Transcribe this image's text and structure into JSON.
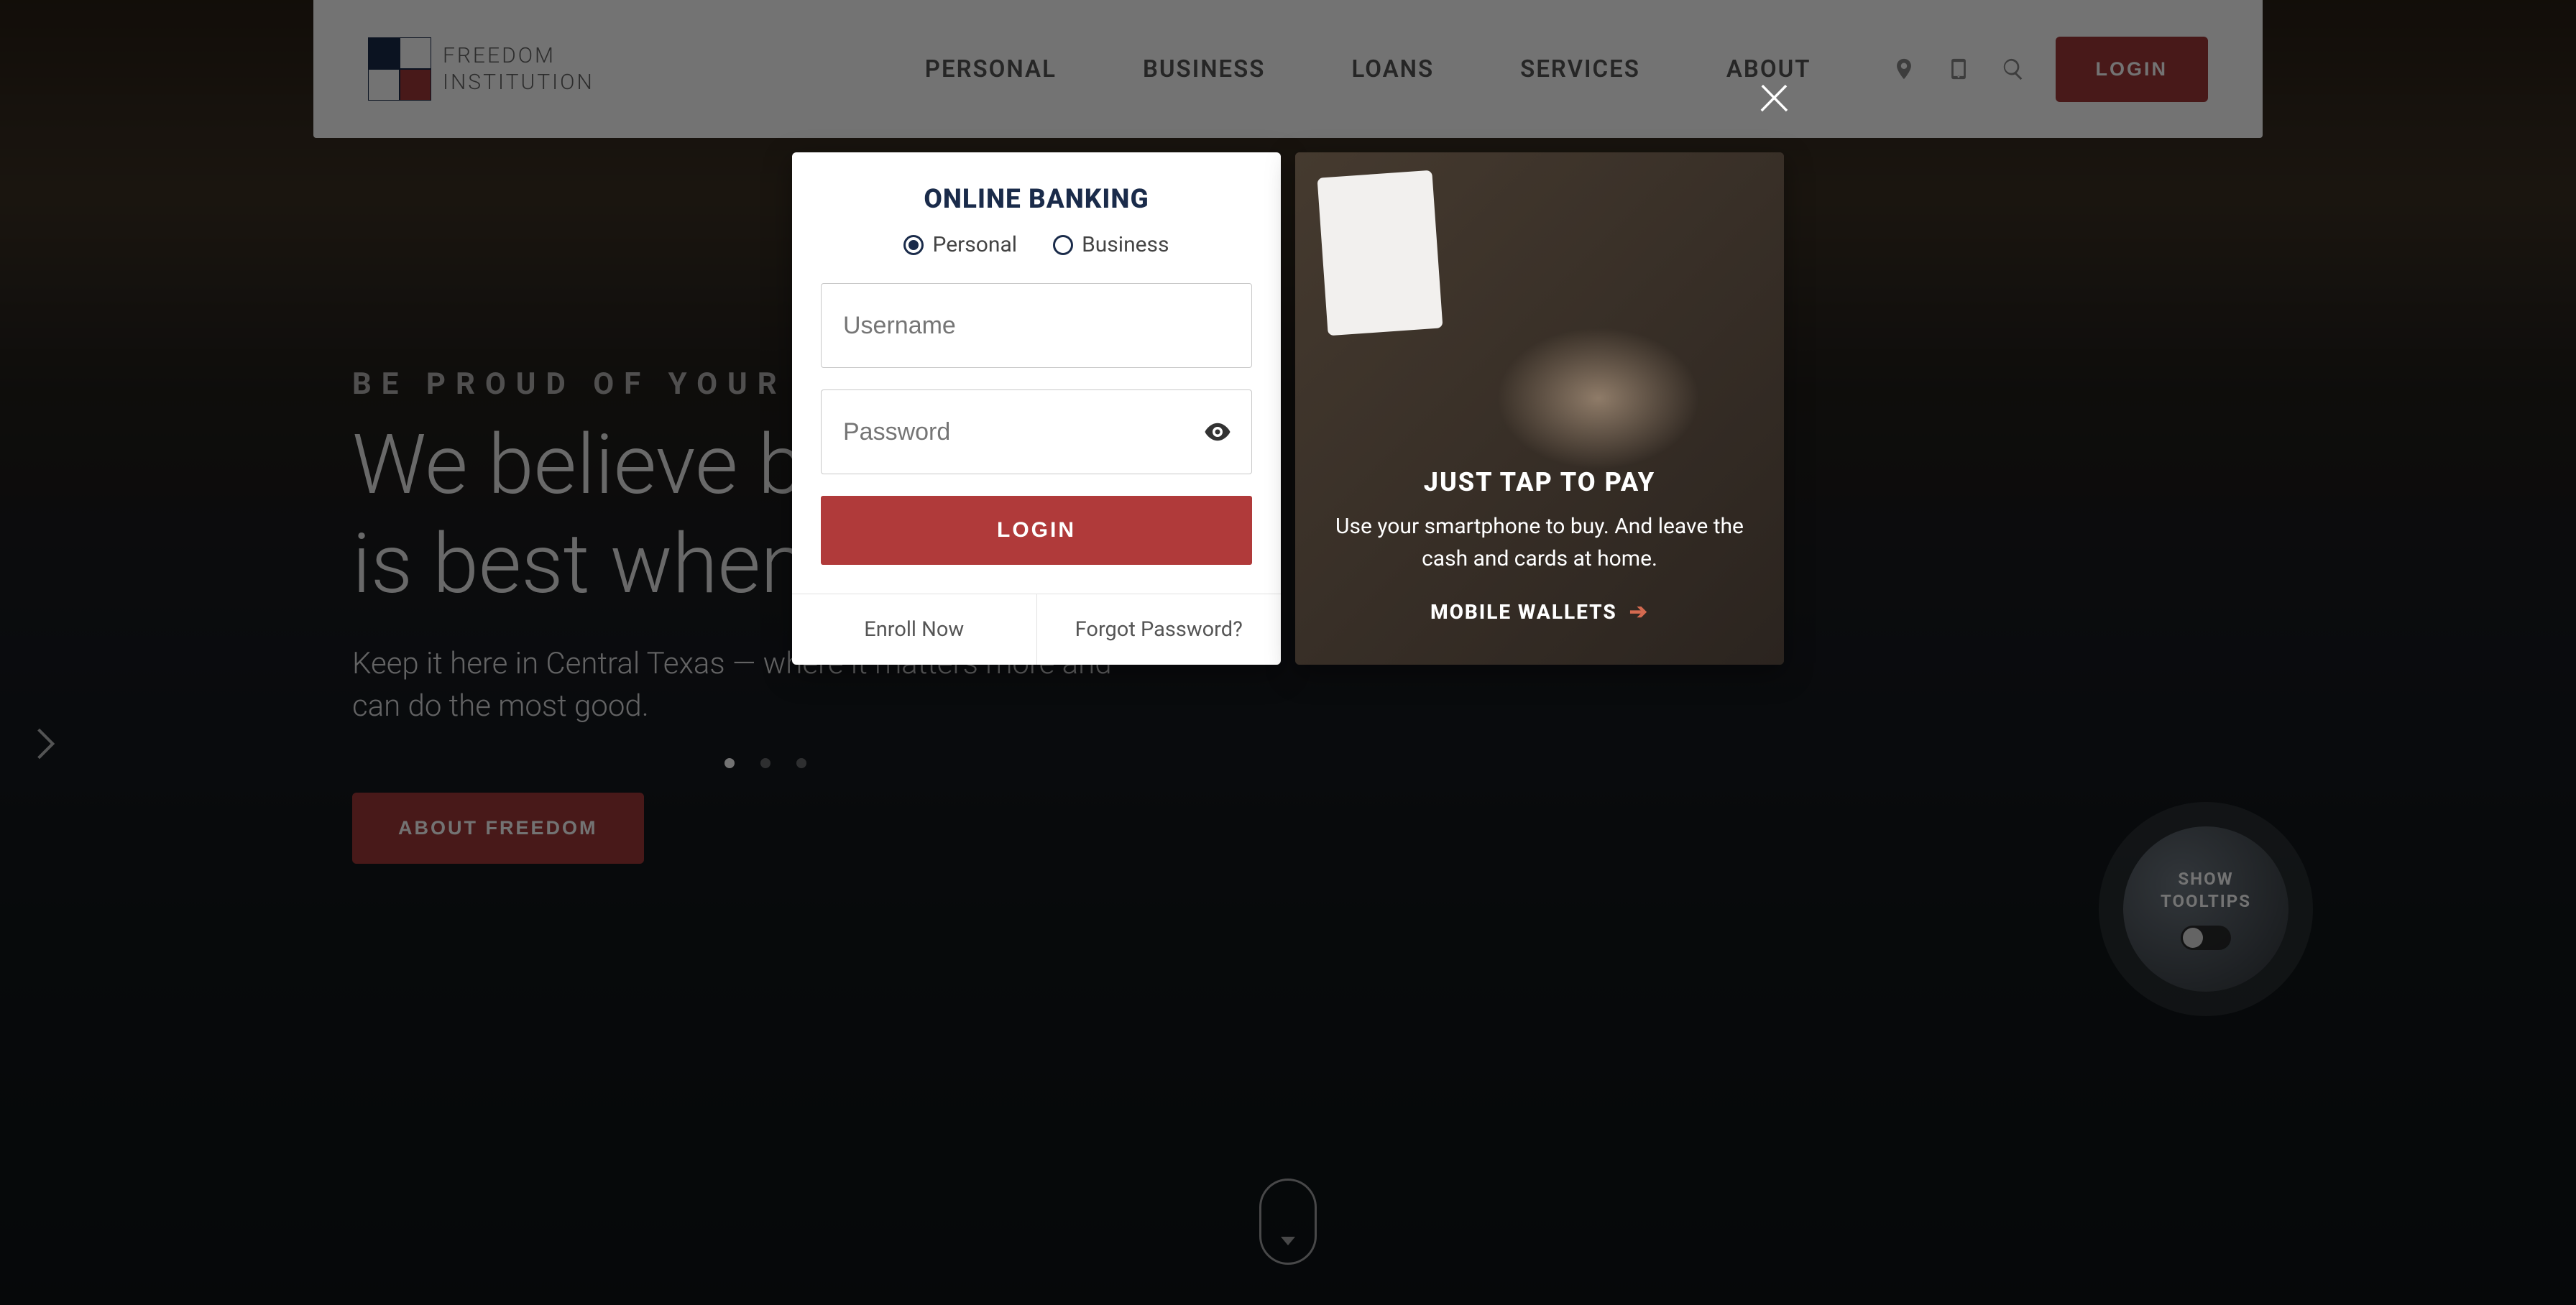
{
  "brand": {
    "line1": "FREEDOM",
    "line2": "INSTITUTION"
  },
  "nav": {
    "items": [
      "PERSONAL",
      "BUSINESS",
      "LOANS",
      "SERVICES",
      "ABOUT"
    ]
  },
  "header": {
    "login_label": "LOGIN"
  },
  "hero": {
    "eyebrow": "BE PROUD OF YOUR MONEY",
    "headline_line1": "We believe banking",
    "headline_line2": "is best when local.",
    "sub": "Keep it here in Central Texas — where it matters more and can do the most good.",
    "cta": "ABOUT FREEDOM"
  },
  "tooltips": {
    "line1": "SHOW",
    "line2": "TOOLTIPS"
  },
  "modal": {
    "close_label": "×",
    "login": {
      "heading": "ONLINE BANKING",
      "radio_personal": "Personal",
      "radio_business": "Business",
      "username_placeholder": "Username",
      "password_placeholder": "Password",
      "submit_label": "LOGIN",
      "enroll_link": "Enroll Now",
      "forgot_link": "Forgot Password?"
    },
    "promo": {
      "heading": "JUST TAP TO PAY",
      "body": "Use your smartphone to buy. And leave the cash and cards at home.",
      "cta": "MOBILE WALLETS",
      "arrow": "➔"
    }
  }
}
